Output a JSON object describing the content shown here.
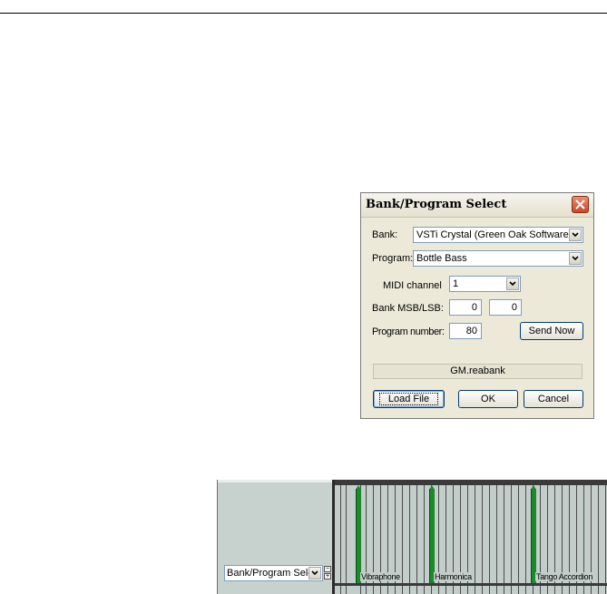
{
  "dialog": {
    "title": "Bank/Program Select",
    "bank_label": "Bank:",
    "bank_value": "VSTi Crystal (Green Oak Software)",
    "program_label": "Program:",
    "program_value": "Bottle Bass",
    "midi_channel_label": "MIDI channel",
    "midi_channel_value": "1",
    "bank_msb_lsb_label": "Bank MSB/LSB:",
    "bank_msb_value": "0",
    "bank_lsb_value": "0",
    "program_number_label": "Program number:",
    "program_number_value": "80",
    "send_now_label": "Send Now",
    "bank_file": "GM.reabank",
    "load_file_label": "Load File",
    "ok_label": "OK",
    "cancel_label": "Cancel"
  },
  "track": {
    "lane_selector_value": "Bank/Program Sele",
    "cc_events": [
      {
        "label": "Vibraphone"
      },
      {
        "label": "Harmonica"
      },
      {
        "label": "Tango Accordion"
      }
    ]
  },
  "colors": {
    "event_green": "#1b8a2a",
    "dialog_bg": "#ece9d8",
    "close_red": "#c9482a"
  }
}
